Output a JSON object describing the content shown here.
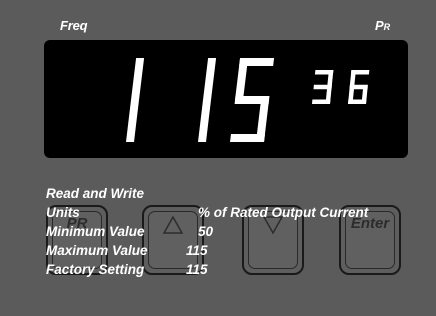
{
  "panel": {
    "freq_label": "Freq",
    "pr_label": "P",
    "pr_sub": "R"
  },
  "display": {
    "main_digits": "115",
    "minor_digits": "36",
    "segment_color": "#ffffff"
  },
  "buttons": {
    "pr_label": "PR",
    "up_label": "Δ",
    "down_label": "▽",
    "enter_label": "Enter"
  },
  "info": {
    "heading": "Read and Write",
    "units_label": "Units",
    "units_value": "% of Rated Output Current",
    "min_label": "Minimum Value",
    "min_value": "50",
    "max_label": "Maximum Value",
    "max_value": "115",
    "factory_label": "Factory Setting",
    "factory_value": "115"
  }
}
